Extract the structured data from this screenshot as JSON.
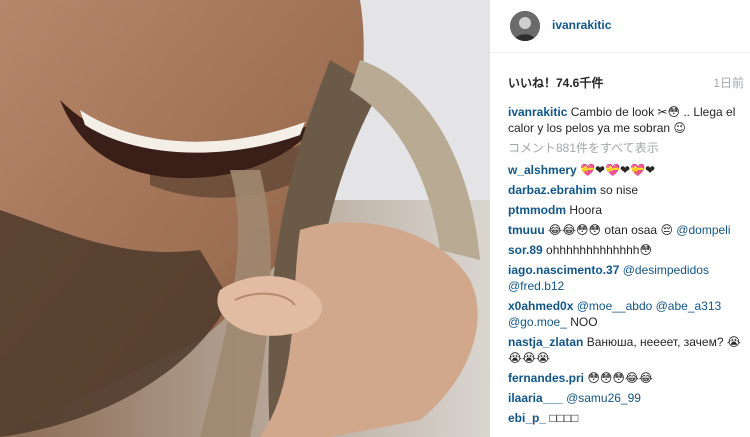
{
  "header": {
    "username": "ivanrakitic"
  },
  "likes_text": "いいね！74.6千件",
  "time_text": "1日前",
  "caption": {
    "user": "ivanrakitic",
    "text": "Cambio de look ✂😳 .. Llega el calor y los pelos ya me sobran 😉"
  },
  "view_all": "コメント881件をすべて表示",
  "comments": [
    {
      "user": "w_alshmery",
      "text": "💝❤💝❤💝❤"
    },
    {
      "user": "darbaz.ebrahim",
      "text": "so nise"
    },
    {
      "user": "ptmmodm",
      "text": "Hoora"
    },
    {
      "user": "tmuuu",
      "pre": "😂😂😳😳 otan osaa 😔 ",
      "mention": "@dompeli"
    },
    {
      "user": "sor.89",
      "text": "ohhhhhhhhhhhhh😳"
    },
    {
      "user": "iago.nascimento.37",
      "mention": "@desimpedidos @fred.b12"
    },
    {
      "user": "x0ahmed0x",
      "mention": "@moe__abdo @abe_a313 @go.moe_",
      "post": " NOO"
    },
    {
      "user": "nastja_zlatan",
      "text": "Ванюша, нееeет, зачем? 😭😭😭😭"
    },
    {
      "user": "fernandes.pri",
      "text": "😳😳😳😂😂"
    },
    {
      "user": "ilaaria___",
      "mention": "@samu26_99"
    },
    {
      "user": "ebi_p_",
      "text": "□□□□"
    }
  ]
}
